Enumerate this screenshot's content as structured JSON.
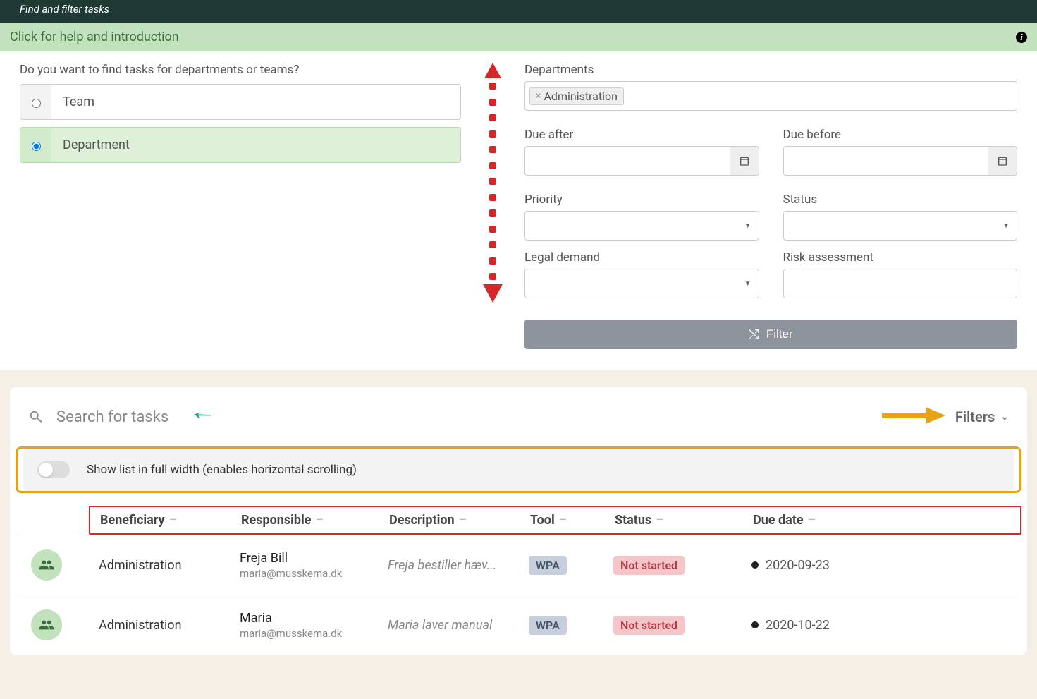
{
  "top": {
    "title": "Find and filter tasks"
  },
  "help": {
    "text": "Click for help and introduction"
  },
  "left": {
    "question": "Do you want to find tasks for departments or teams?",
    "options": {
      "team": "Team",
      "department": "Department"
    }
  },
  "right": {
    "departments_label": "Departments",
    "departments_tag": "Administration",
    "due_after_label": "Due after",
    "due_before_label": "Due before",
    "priority_label": "Priority",
    "status_label": "Status",
    "legal_label": "Legal demand",
    "risk_label": "Risk assessment",
    "filter_button": "Filter"
  },
  "results": {
    "search_placeholder": "Search for tasks",
    "filters_label": "Filters",
    "toggle_label": "Show list in full width (enables horizontal scrolling)",
    "columns": {
      "beneficiary": "Beneficiary",
      "responsible": "Responsible",
      "description": "Description",
      "tool": "Tool",
      "status": "Status",
      "due": "Due date"
    },
    "rows": [
      {
        "beneficiary": "Administration",
        "resp_name": "Freja Bill",
        "resp_email": "maria@musskema.dk",
        "description": "Freja bestiller hæv...",
        "tool": "WPA",
        "status": "Not started",
        "due": "2020-09-23"
      },
      {
        "beneficiary": "Administration",
        "resp_name": "Maria",
        "resp_email": "maria@musskema.dk",
        "description": "Maria laver manual",
        "tool": "WPA",
        "status": "Not started",
        "due": "2020-10-22"
      }
    ]
  }
}
